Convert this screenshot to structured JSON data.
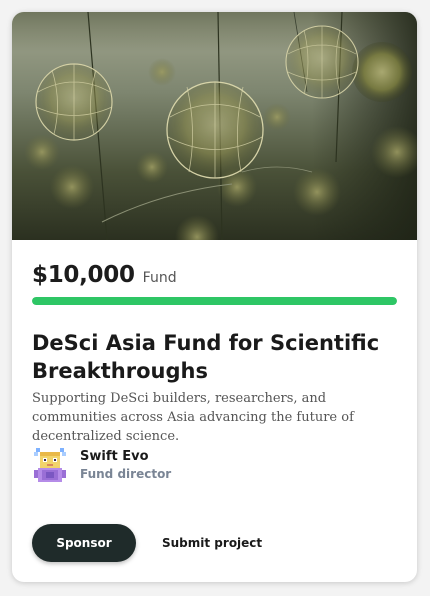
{
  "card": {
    "amount": "$10,000",
    "amount_unit": "Fund",
    "progress": 1.0,
    "progress_color": "#2ec665",
    "title": "DeSci Asia Fund for Scientific Breakthroughs",
    "description": "Supporting DeSci builders, researchers, and communities across Asia advancing the future of decentralized science.",
    "director": {
      "name": "Swift Evo",
      "role": "Fund director",
      "avatar_icon": "pixel-character-avatar"
    },
    "actions": {
      "sponsor_label": "Sponsor",
      "submit_label": "Submit project"
    },
    "hero_image": "underwater-plankton-photo"
  }
}
